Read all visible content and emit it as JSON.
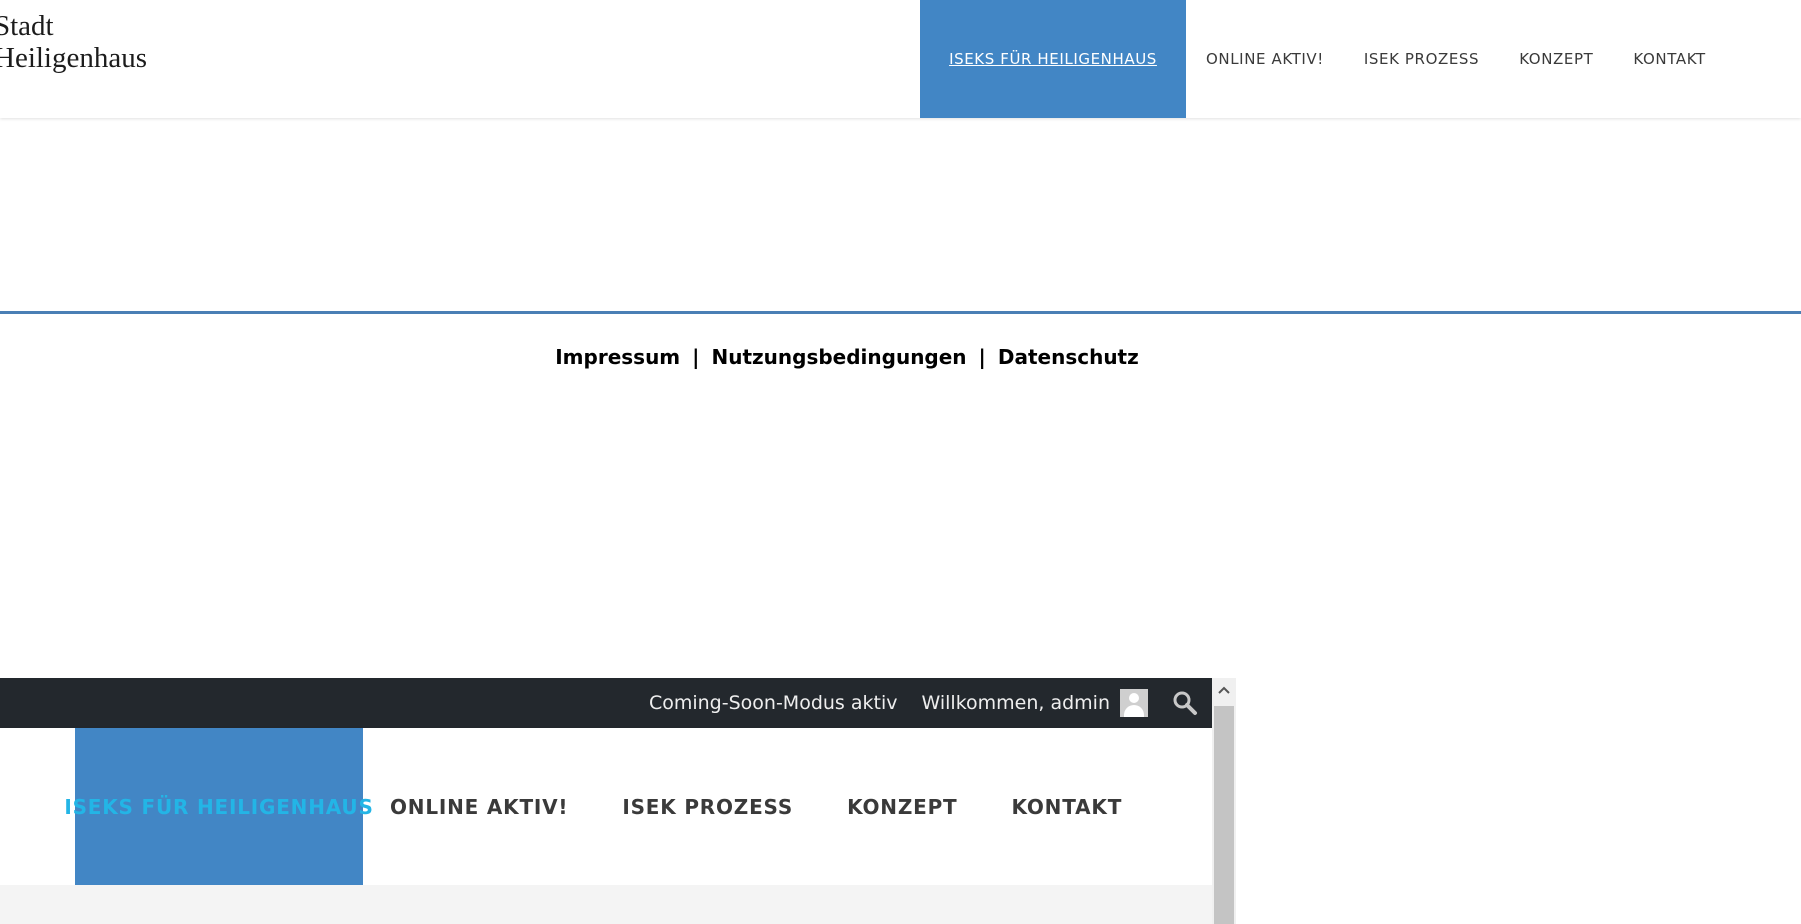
{
  "header": {
    "logo_line1": "Stadt",
    "logo_line2": "Heiligenhaus",
    "nav": [
      {
        "label": "ISEKS FÜR HEILIGENHAUS",
        "active": true
      },
      {
        "label": "ONLINE AKTIV!"
      },
      {
        "label": "ISEK PROZESS"
      },
      {
        "label": "KONZEPT"
      },
      {
        "label": "KONTAKT"
      }
    ]
  },
  "footer": {
    "links": [
      "Impressum",
      "Nutzungsbedingungen",
      "Datenschutz"
    ],
    "separator": "|"
  },
  "preview": {
    "admin_bar": {
      "coming_soon": "Coming-Soon-Modus aktiv",
      "welcome": "Willkommen, admin"
    },
    "nav": [
      {
        "label": "ISEKS FÜR HEILIGENHAUS",
        "active": true
      },
      {
        "label": "ONLINE AKTIV!"
      },
      {
        "label": "ISEK PROZESS"
      },
      {
        "label": "KONZEPT"
      },
      {
        "label": "KONTAKT"
      }
    ]
  },
  "colors": {
    "accent": "#4286c5",
    "divider": "#4a7fb5",
    "admin_bar": "#23282d",
    "preview_active_text": "#23b5e6"
  },
  "icons": [
    "user-avatar-icon",
    "search-icon",
    "scroll-up-arrow-icon"
  ]
}
